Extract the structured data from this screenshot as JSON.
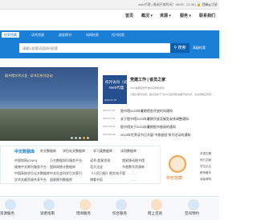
{
  "topbar": {
    "info": "web代理 | 借阅开放时间：08:00 - 22:30 | 🔒 登录 | 注册",
    "login": "Eng"
  },
  "nav": {
    "items": [
      "首页",
      "概况 ▾",
      "资源 ▾",
      "服务 ▾",
      "联系我们"
    ]
  },
  "search_tabs": [
    "检索馆藏",
    "读秀资源",
    "超星期刊",
    "知网检索",
    "找书检索"
  ],
  "search": {
    "placeholder": "请输入检索词语进行检索",
    "button": "搜索",
    "advanced": "高级检索"
  },
  "banner": {
    "caption": "图书馆学术沙龙 · 读书月系列活动",
    "dots": 5,
    "active_dot": 4
  },
  "featured": {
    "img_line1": "校外访问（试用）",
    "img_line2": "Web代理",
    "img_date": "2023-07-07",
    "title": "党建工作 | 省员之家",
    "lines": [
      "2023暑期馆舍开放时间调整通知",
      "为更好服务读者，图书馆将于7月10日起调整暑期开放时间，请读者相互转告……"
    ]
  },
  "news": [
    {
      "date": "2023-07-06",
      "title": "图书馆2023年暑期馆舍开放时间通知"
    },
    {
      "date": "2023-07-05",
      "title": "关于图书馆2023年暑期开放及服务安排调整通知"
    },
    {
      "date": "2023-06-30",
      "title": "图书馆关于2023年暑期图书借阅的通知"
    },
    {
      "date": "2023-06-28",
      "title": "2023年世界读书日开展“书香校园”系列活动的通知"
    }
  ],
  "databases": {
    "tabs": [
      "中文数据库",
      "外文数据库",
      "学位论文数据库",
      "学习类数据库",
      "试用数据库"
    ],
    "rows": [
      [
        "中国知网(CNKI)",
        "万方数据知识服务平台",
        "读秀·超星发现",
        "超星移动图书馆"
      ],
      [
        "维普中文期刊服务平台",
        "国研网统计数据库",
        "北大法宝",
        "书香数字资源库"
      ],
      [
        "中国高校学位论文数据库",
        "中文社会科学引文索引",
        "《人民日报》图文电子版",
        "……"
      ],
      [
        "学术文献资源共享平台",
        "超星期刊数据库",
        "博看书苑",
        "……"
      ]
    ]
  },
  "special": {
    "label": "特色馆藏",
    "links": [
      "本馆古籍",
      "地方文献",
      "学位论文",
      "教师著作",
      "读者荐购"
    ]
  },
  "services": [
    "资源服务",
    "读者指南",
    "借阅服务",
    "综合服务",
    "网上咨询",
    "空间预约"
  ],
  "colors": {
    "primary": "#1c7fd6",
    "accent": "#f29a2e"
  }
}
